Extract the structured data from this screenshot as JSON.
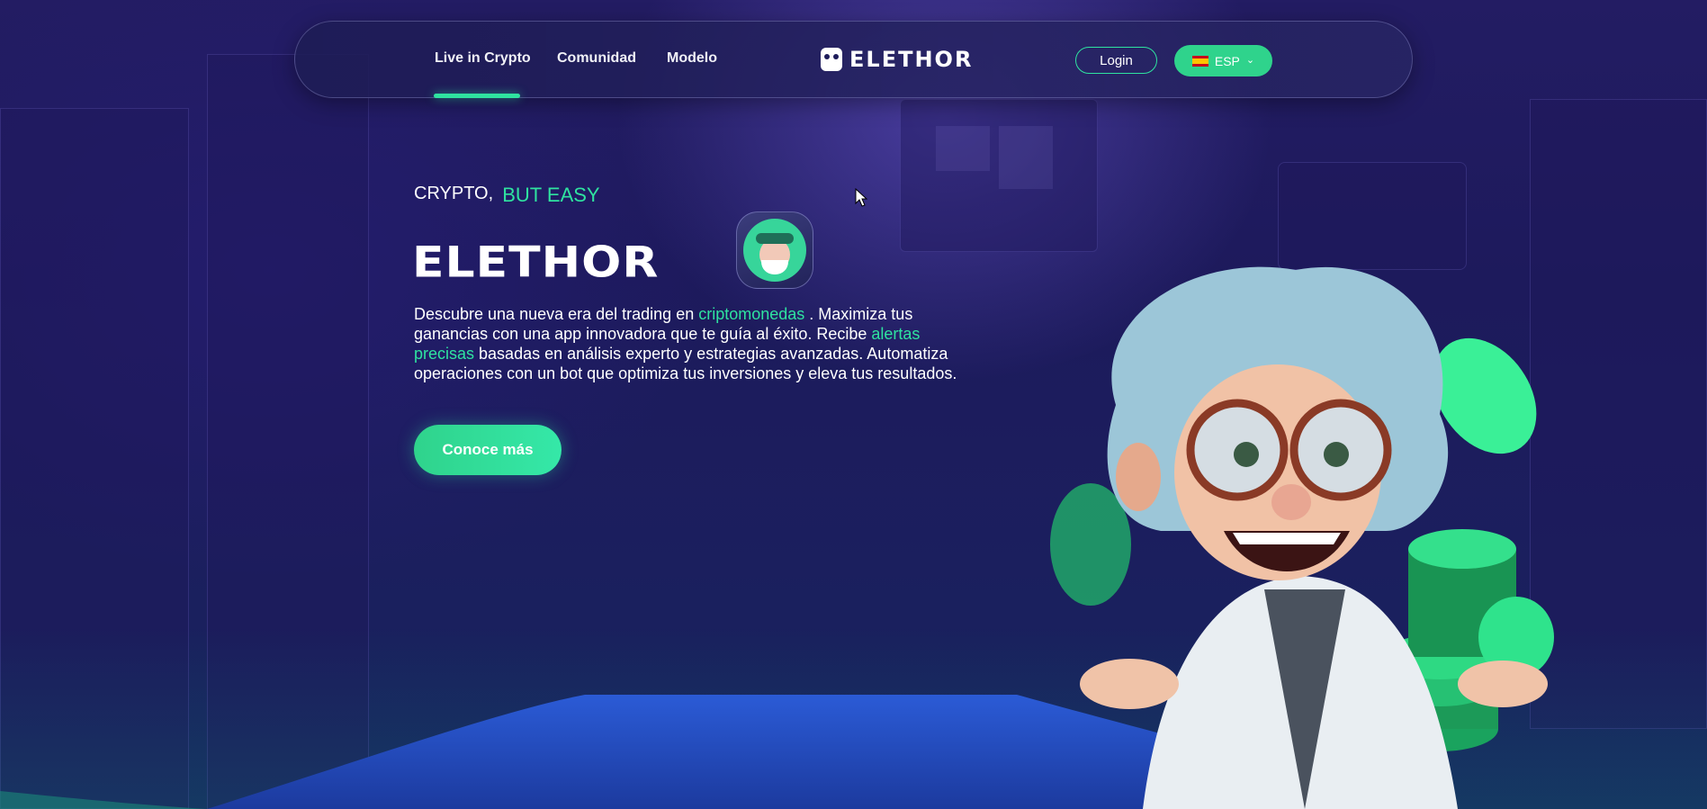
{
  "nav": {
    "links": [
      {
        "label": "Live in Crypto",
        "active": true
      },
      {
        "label": "Comunidad",
        "active": false
      },
      {
        "label": "Modelo",
        "active": false
      }
    ],
    "brand": "ELETHOR",
    "login_label": "Login",
    "language": {
      "flag": "es-flag-icon",
      "code": "ESP"
    }
  },
  "hero": {
    "tagline_prefix": "CRYPTO,",
    "tagline_accent": "BUT EASY",
    "title": "ELETHOR",
    "description_parts": [
      "Descubre una nueva era del trading en ",
      "criptomonedas",
      " . Maximiza tus ganancias con una app innovadora que te guía al éxito. Recibe ",
      "alertas precisas",
      " basadas en análisis experto y estrategias avanzadas. Automatiza operaciones con un bot que optimiza tus inversiones y eleva tus resultados."
    ],
    "cta_label": "Conoce más"
  },
  "colors": {
    "accent": "#2fe3a0",
    "background": "#1d1a5c",
    "nav_bg": "#1e1c55"
  },
  "icons": {
    "brand": "elethor-logo-icon",
    "badge": "scientist-avatar-icon",
    "chevron": "chevron-down-icon",
    "cursor": "mouse-cursor-icon"
  }
}
